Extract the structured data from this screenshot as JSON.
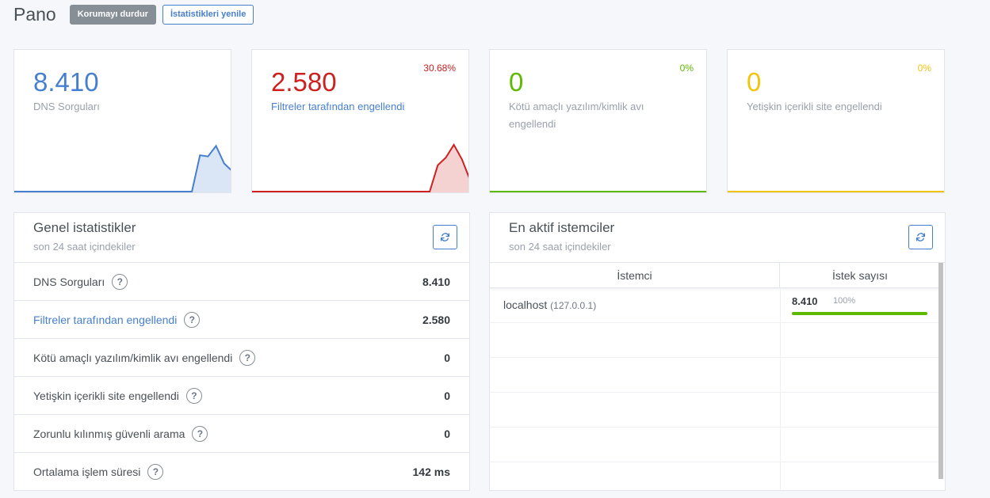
{
  "header": {
    "title": "Pano",
    "stop_protection_label": "Korumayı durdur",
    "refresh_stats_label": "İstatistikleri yenile"
  },
  "cards": [
    {
      "value": "8.410",
      "label": "DNS Sorguları",
      "percent": "",
      "color": "#467fcf",
      "sparkline": [
        0,
        0,
        0,
        0,
        0,
        0,
        0,
        0,
        0,
        0,
        0,
        0,
        0,
        0,
        0,
        0,
        0,
        0,
        0,
        0,
        0,
        0,
        0,
        0.62,
        0.6,
        0.78,
        0.48,
        0.35
      ]
    },
    {
      "value": "2.580",
      "label": "Filtreler tarafından engellendi",
      "percent": "30.68%",
      "color": "#cd201f",
      "sparkline": [
        0,
        0,
        0,
        0,
        0,
        0,
        0,
        0,
        0,
        0,
        0,
        0,
        0,
        0,
        0,
        0,
        0,
        0,
        0,
        0,
        0,
        0,
        0,
        0.45,
        0.58,
        0.8,
        0.55,
        0.2
      ]
    },
    {
      "value": "0",
      "label": "Kötü amaçlı yazılım/kimlik avı engellendi",
      "percent": "0%",
      "color": "#5eba00",
      "sparkline": []
    },
    {
      "value": "0",
      "label": "Yetişkin içerikli site engellendi",
      "percent": "0%",
      "color": "#f1c40f",
      "sparkline": []
    }
  ],
  "general_stats": {
    "title": "Genel istatistikler",
    "subtitle": "son 24 saat içindekiler",
    "help_symbol": "?",
    "rows": [
      {
        "label": "DNS Sorguları",
        "value": "8.410"
      },
      {
        "label": "Filtreler tarafından engellendi",
        "value": "2.580"
      },
      {
        "label": "Kötü amaçlı yazılım/kimlik avı engellendi",
        "value": "0"
      },
      {
        "label": "Yetişkin içerikli site engellendi",
        "value": "0"
      },
      {
        "label": "Zorunlu kılınmış güvenli arama",
        "value": "0"
      },
      {
        "label": "Ortalama işlem süresi",
        "value": "142 ms"
      }
    ]
  },
  "top_clients": {
    "title": "En aktif istemciler",
    "subtitle": "son 24 saat içindekiler",
    "col_client": "İstemci",
    "col_count": "İstek sayısı",
    "rows": [
      {
        "name": "localhost",
        "ip": "(127.0.0.1)",
        "count": "8.410",
        "percent": "100%",
        "fill": 1.0
      }
    ]
  }
}
